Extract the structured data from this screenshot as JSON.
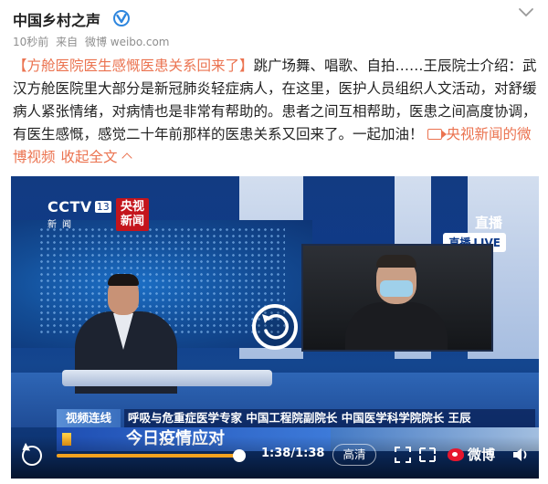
{
  "header": {
    "user_name": "中国乡村之声",
    "meta_time": "10秒前",
    "meta_from": "来自",
    "meta_source": "微博 weibo.com"
  },
  "post": {
    "title_tag": "【方舱医院医生感慨医患关系回来了】",
    "body": "跳广场舞、唱歌、自拍……王辰院士介绍：武汉方舱医院里大部分是新冠肺炎轻症病人，在这里，医护人员组织人文活动，对舒缓病人紧张情绪，对病情也是非常有帮助的。患者之间互相帮助，医患之间高度协调，有医生感慨，感觉二十年前那样的医患关系又回来了。一起加油！",
    "video_link": "央视新闻的微博视频",
    "collapse": "收起全文"
  },
  "video": {
    "channel": "CCTV",
    "channel_number": "13",
    "channel_sub": "新闻",
    "badge_line1": "央视",
    "badge_line2": "新闻",
    "live_top": "直播",
    "live_badge_cn": "直播",
    "live_badge_en": "LIVE",
    "tag_live": "视频连线",
    "expert_title": "呼吸与危重症医学专家  中国工程院副院长  中国医学科学院院长  王辰",
    "program_title": "今日疫情应对",
    "time": "1:38/1:38",
    "progress": 1.0,
    "quality": "高清",
    "weibo_brand": "微博"
  },
  "colors": {
    "accent": "#eb7350",
    "verified": "#2e86de",
    "progress": "#f4a21f"
  },
  "icons": [
    "verified-icon",
    "more-icon",
    "video-camera-icon",
    "chevron-up-icon",
    "replay-icon",
    "fullscreen-icon",
    "pip-icon",
    "weibo-logo-icon",
    "volume-icon"
  ]
}
